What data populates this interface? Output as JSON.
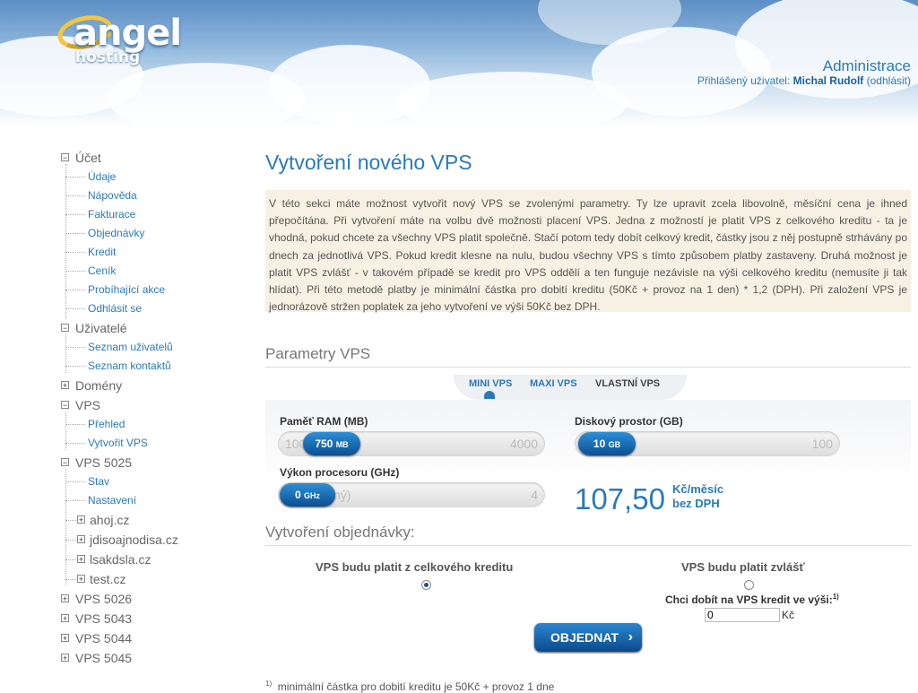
{
  "header": {
    "logo_main": "angel",
    "logo_sub": "hosting",
    "admin_title": "Administrace",
    "user_prefix": "Přihlášený uživatel:",
    "user_name": "Michal Rudolf",
    "logout": "(odhlásit)"
  },
  "sidebar": {
    "sections": [
      {
        "label": "Účet",
        "toggle": "−",
        "items": [
          "Údaje",
          "Nápověda",
          "Fakturace",
          "Objednávky",
          "Kredit",
          "Ceník",
          "Probíhající akce",
          "Odhlásit se"
        ]
      },
      {
        "label": "Uživatelé",
        "toggle": "−",
        "items": [
          "Seznam uživatelů",
          "Seznam kontaktů"
        ]
      },
      {
        "label": "Domény",
        "toggle": "+",
        "items": []
      },
      {
        "label": "VPS",
        "toggle": "−",
        "items": [
          "Přehled",
          "Vytvořit VPS"
        ]
      },
      {
        "label": "VPS 5025",
        "toggle": "−",
        "items": [
          "Stav",
          "Nastavení"
        ],
        "domains": [
          "ahoj.cz",
          "jdisoajnodisa.cz",
          "lsakdsla.cz",
          "test.cz"
        ]
      },
      {
        "label": "VPS 5026",
        "toggle": "+"
      },
      {
        "label": "VPS 5043",
        "toggle": "+"
      },
      {
        "label": "VPS 5044",
        "toggle": "+"
      },
      {
        "label": "VPS 5045",
        "toggle": "+"
      }
    ]
  },
  "main": {
    "title": "Vytvoření nového VPS",
    "info": "V této sekci máte možnost vytvořit nový VPS se zvolenými parametry. Ty lze upravit zcela libovolně, měsíční cena je ihned přepočítána. Při vytvoření máte na volbu dvě možnosti placení VPS. Jedna z možností je platit VPS z celkového kreditu - ta je vhodná, pokud chcete za všechny VPS platit společně. Stačí potom tedy dobít celkový kredit, částky jsou z něj postupně strhávány po dnech za jednotlivá VPS. Pokud kredit klesne na nulu, budou všechny VPS s tímto způsobem platby zastaveny. Druhá možnost je platit VPS zvlášť - v takovém případě se kredit pro VPS oddělí a ten funguje nezávisle na výši celkového kreditu (nemusíte ji tak hlídat). Při této metodě platby je minimální částka pro dobití kreditu (50Kč + provoz na 1 den) * 1,2 (DPH). Při založení VPS je jednorázově stržen poplatek za jeho vytvoření ve výši 50Kč bez DPH.",
    "params_heading": "Parametry VPS",
    "tabs": [
      "MINI VPS",
      "MAXI VPS",
      "VLASTNÍ VPS"
    ],
    "ram": {
      "label": "Paměť RAM (MB)",
      "min": "100",
      "max": "4000",
      "value": "750",
      "unit": "MB"
    },
    "disk": {
      "label": "Diskový prostor (GB)",
      "max": "100",
      "value": "10",
      "unit": "GB"
    },
    "cpu": {
      "label": "Výkon procesoru (GHz)",
      "min_hint": "ný)",
      "max": "4",
      "value": "0",
      "unit": "GHz"
    },
    "price": {
      "value": "107,50",
      "unit1": "Kč/měsíc",
      "unit2": "bez DPH"
    },
    "order_heading": "Vytvoření objednávky:",
    "pay_credit": "VPS budu platit z celkového kreditu",
    "pay_separate": "VPS budu platit zvlášť",
    "topup_label": "Chci dobít na VPS kredit ve výši:",
    "topup_sup": "1)",
    "topup_value": "0",
    "currency": "Kč",
    "order_button": "OBJEDNAT",
    "footnote_sup": "1)",
    "footnote": "minimální částka pro dobití kreditu je 50Kč + provoz 1 dne"
  }
}
